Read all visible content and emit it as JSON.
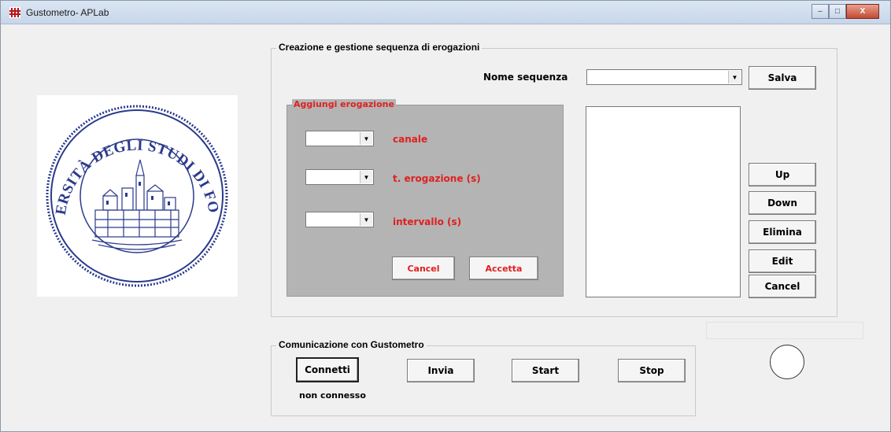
{
  "window": {
    "title": "Gustometro- APLab",
    "minimize_symbol": "–",
    "maximize_symbol": "□",
    "close_symbol": "X"
  },
  "logo": {
    "text": "UNIVERSITÀ DEGLI STUDI DI FOGGIA",
    "ring_color": "#2b3a8c"
  },
  "sequence_group": {
    "title": "Creazione e gestione sequenza di erogazioni",
    "name_label": "Nome sequenza",
    "name_value": "",
    "save_label": "Salva",
    "list_items": [],
    "up_label": "Up",
    "down_label": "Down",
    "delete_label": "Elimina",
    "edit_label": "Edit",
    "cancel_label": "Cancel"
  },
  "add_group": {
    "title": "Aggiungi erogazione",
    "channel_label": "canale",
    "channel_value": "",
    "duration_label": "t. erogazione (s)",
    "duration_value": "",
    "interval_label": "intervallo (s)",
    "interval_value": "",
    "cancel_label": "Cancel",
    "accept_label": "Accetta",
    "accent_color": "#e02020"
  },
  "comm_group": {
    "title": "Comunicazione con Gustometro",
    "connect_label": "Connetti",
    "send_label": "Invia",
    "start_label": "Start",
    "stop_label": "Stop",
    "status_text": "non connesso"
  }
}
